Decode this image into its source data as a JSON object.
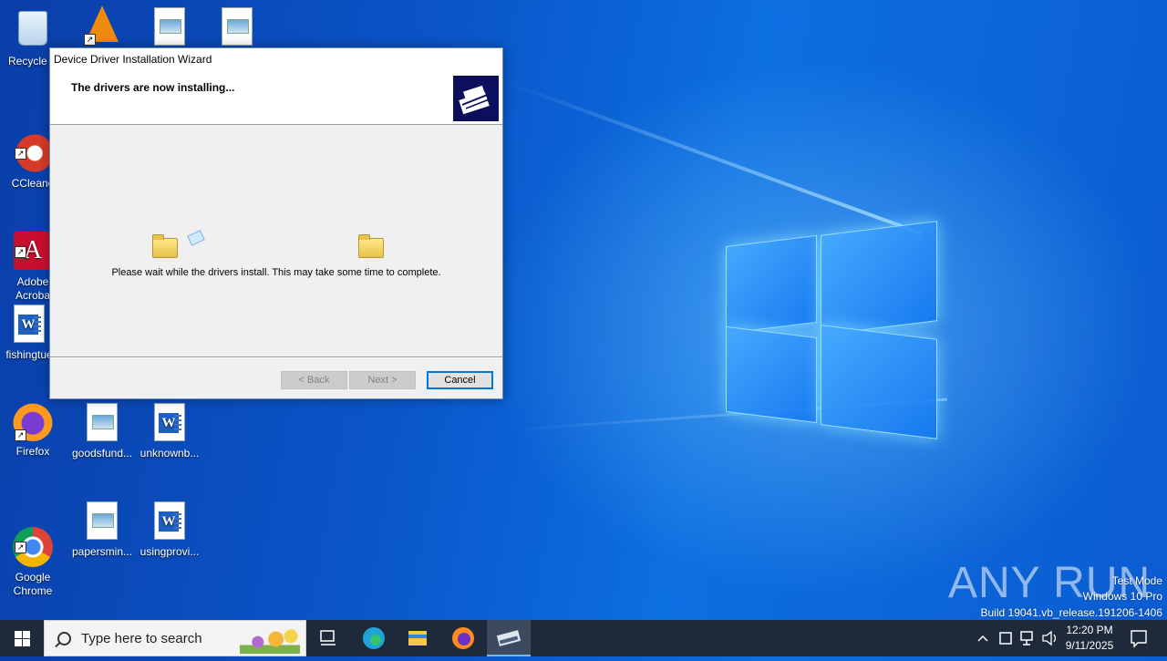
{
  "desktop": {
    "icons": [
      {
        "label": "Recycle B"
      },
      {
        "label": "CCleane"
      },
      {
        "label": "Adobe\nAcroba"
      },
      {
        "label": "fishingtue"
      },
      {
        "label": "Firefox"
      },
      {
        "label": "goodsfund..."
      },
      {
        "label": "unknownb..."
      },
      {
        "label": "Google\nChrome"
      },
      {
        "label": "papersmin..."
      },
      {
        "label": "usingprovi..."
      }
    ]
  },
  "wizard": {
    "title": "Device Driver Installation Wizard",
    "heading": "The drivers are now installing...",
    "message": "Please wait while the drivers install. This may take some time to complete.",
    "back_label": "< Back",
    "next_label": "Next >",
    "cancel_label": "Cancel"
  },
  "watermark": {
    "brand": "ANY RUN",
    "line1": "Test Mode",
    "line2": "Windows 10 Pro",
    "line3": "Build 19041.vb_release.191206-1406"
  },
  "taskbar": {
    "search_placeholder": "Type here to search",
    "time": "12:20 PM",
    "date": "9/11/2025"
  },
  "colors": {
    "accent": "#0078d7",
    "taskbar": "#1e2a3a"
  }
}
